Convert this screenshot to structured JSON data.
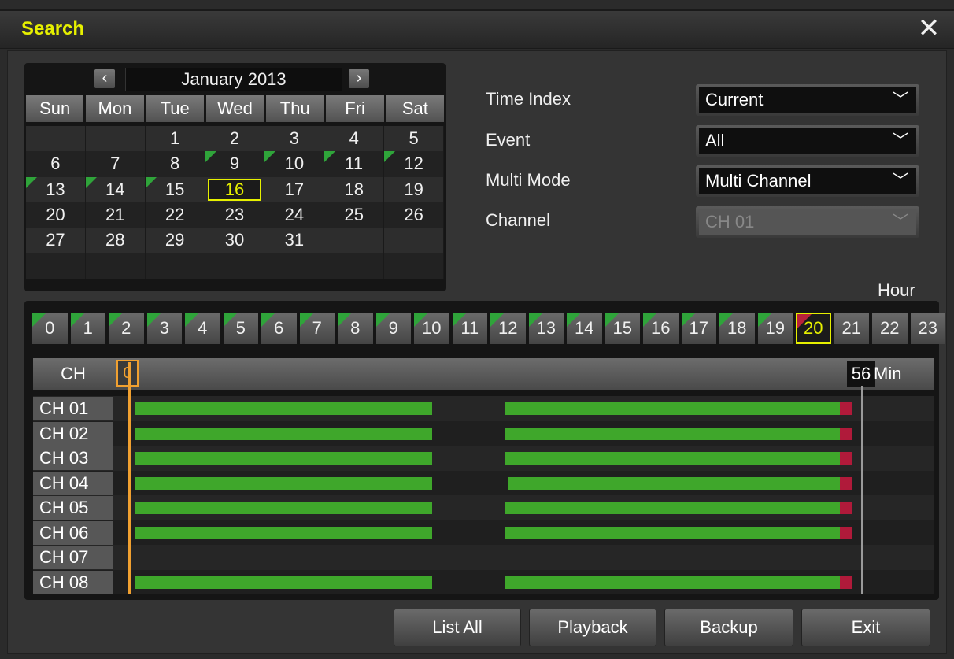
{
  "window": {
    "title": "Search",
    "close_glyph": "✕"
  },
  "calendar": {
    "title": "January 2013",
    "prev": "‹",
    "next": "›",
    "weekdays": [
      "Sun",
      "Mon",
      "Tue",
      "Wed",
      "Thu",
      "Fri",
      "Sat"
    ],
    "weeks": [
      [
        "",
        "",
        "1",
        "2",
        "3",
        "4",
        "5"
      ],
      [
        "6",
        "7",
        "8",
        "9",
        "10",
        "11",
        "12"
      ],
      [
        "13",
        "14",
        "15",
        "16",
        "17",
        "18",
        "19"
      ],
      [
        "20",
        "21",
        "22",
        "23",
        "24",
        "25",
        "26"
      ],
      [
        "27",
        "28",
        "29",
        "30",
        "31",
        "",
        ""
      ],
      [
        "",
        "",
        "",
        "",
        "",
        "",
        ""
      ]
    ],
    "days_with_data": [
      "9",
      "10",
      "11",
      "12",
      "13",
      "14",
      "15"
    ],
    "selected_day": "16"
  },
  "settings": {
    "time_index": {
      "label": "Time Index",
      "value": "Current"
    },
    "event": {
      "label": "Event",
      "value": "All"
    },
    "multi_mode": {
      "label": "Multi Mode",
      "value": "Multi Channel"
    },
    "channel": {
      "label": "Channel",
      "value": "CH 01",
      "disabled": true
    }
  },
  "hours": {
    "label": "Hour",
    "values": [
      "0",
      "1",
      "2",
      "3",
      "4",
      "5",
      "6",
      "7",
      "8",
      "9",
      "10",
      "11",
      "12",
      "13",
      "14",
      "15",
      "16",
      "17",
      "18",
      "19",
      "20",
      "21",
      "22",
      "23"
    ],
    "with_data": [
      "0",
      "1",
      "2",
      "3",
      "4",
      "5",
      "6",
      "7",
      "8",
      "9",
      "10",
      "11",
      "12",
      "13",
      "14",
      "15",
      "16",
      "17",
      "18",
      "19"
    ],
    "event_hour": "20",
    "selected_hour": "20"
  },
  "timeline": {
    "ch_header": "CH",
    "min_start": "0",
    "min_end": "56",
    "min_label": "Min",
    "channels": [
      {
        "name": "CH 01",
        "segments": [
          [
            0.0,
            0.41
          ],
          [
            0.51,
            0.99
          ]
        ],
        "event_end": true
      },
      {
        "name": "CH 02",
        "segments": [
          [
            0.0,
            0.41
          ],
          [
            0.51,
            0.99
          ]
        ],
        "event_end": true
      },
      {
        "name": "CH 03",
        "segments": [
          [
            0.0,
            0.41
          ],
          [
            0.51,
            0.99
          ]
        ],
        "event_end": true
      },
      {
        "name": "CH 04",
        "segments": [
          [
            0.0,
            0.41
          ],
          [
            0.515,
            0.99
          ]
        ],
        "event_end": true
      },
      {
        "name": "CH 05",
        "segments": [
          [
            0.0,
            0.41
          ],
          [
            0.51,
            0.99
          ]
        ],
        "event_end": true
      },
      {
        "name": "CH 06",
        "segments": [
          [
            0.0,
            0.41
          ],
          [
            0.51,
            0.99
          ]
        ],
        "event_end": true
      },
      {
        "name": "CH 07",
        "segments": [],
        "event_end": false
      },
      {
        "name": "CH 08",
        "segments": [
          [
            0.0,
            0.41
          ],
          [
            0.51,
            0.99
          ]
        ],
        "event_end": true
      }
    ]
  },
  "buttons": {
    "list_all": "List All",
    "playback": "Playback",
    "backup": "Backup",
    "exit": "Exit"
  },
  "colors": {
    "accent": "#e6f000",
    "data": "#3fa72b",
    "event": "#b01a3a",
    "cursor": "#f0a030"
  },
  "icons": {
    "prev": "chevron-left-icon",
    "next": "chevron-right-icon",
    "dropdown": "chevron-down-icon",
    "close": "close-icon"
  }
}
